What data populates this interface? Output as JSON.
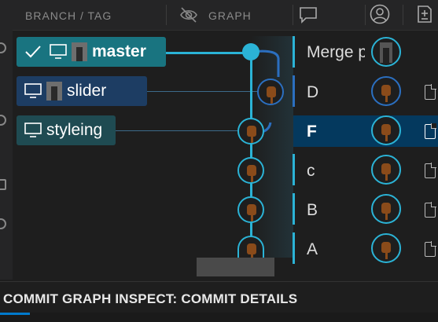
{
  "header": {
    "branch_tag_label": "BRANCH / TAG",
    "graph_label": "GRAPH",
    "icons": [
      "eye-off-icon",
      "comment-icon",
      "account-icon",
      "diff-icon"
    ]
  },
  "branches": [
    {
      "name": "master",
      "checked": true,
      "has_avatar": true,
      "color": "#197480"
    },
    {
      "name": "slider",
      "checked": false,
      "has_avatar": true,
      "color": "#1d3d63"
    },
    {
      "name": "styleing",
      "checked": false,
      "has_avatar": false,
      "color": "#1f4b52"
    }
  ],
  "commits": [
    {
      "message": "Merge p",
      "selected": false
    },
    {
      "message": "D",
      "selected": false
    },
    {
      "message": "F",
      "selected": true
    },
    {
      "message": "c",
      "selected": false
    },
    {
      "message": "B",
      "selected": false
    },
    {
      "message": "A",
      "selected": false
    }
  ],
  "panel": {
    "title": "COMMIT GRAPH INSPECT: COMMIT DETAILS"
  },
  "colors": {
    "accent": "#2bb3d6",
    "selected_row": "#04395e",
    "master_pill": "#197480"
  }
}
